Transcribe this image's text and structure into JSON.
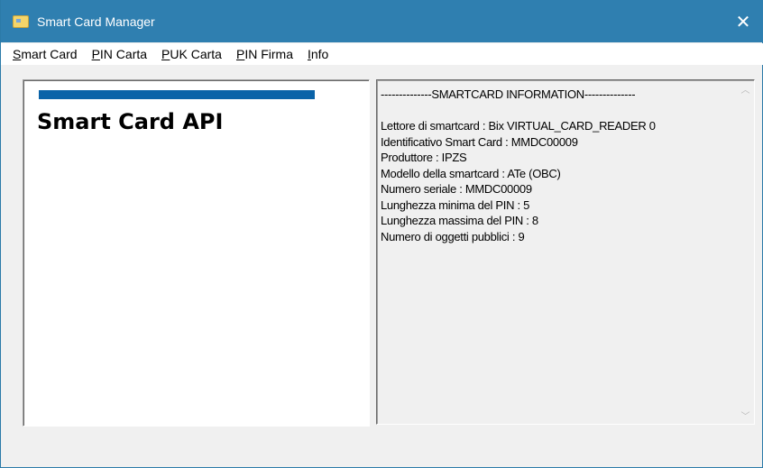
{
  "window": {
    "title": "Smart Card Manager",
    "close_glyph": "✕"
  },
  "menu": [
    {
      "label": "Smart Card",
      "accel": "S",
      "rest": "mart Card"
    },
    {
      "label": "PIN Carta",
      "accel": "P",
      "rest": "IN Carta"
    },
    {
      "label": "PUK Carta",
      "accel": "P",
      "rest": "UK Carta"
    },
    {
      "label": "PIN Firma",
      "accel": "P",
      "rest": "IN Firma"
    },
    {
      "label": "Info",
      "accel": "I",
      "rest": "nfo"
    }
  ],
  "left_panel": {
    "heading": "Smart Card API",
    "accent_color": "#0a63a8"
  },
  "info": {
    "header": "--------------SMARTCARD INFORMATION--------------",
    "lines": [
      "Lettore di smartcard : Bix VIRTUAL_CARD_READER 0",
      "Identificativo Smart Card : MMDC00009",
      "Produttore : IPZS",
      "Modello della smartcard : ATe (OBC)",
      "Numero seriale : MMDC00009",
      "Lunghezza minima del PIN : 5",
      "Lunghezza massima del PIN : 8",
      "Numero di oggetti pubblici : 9"
    ]
  },
  "scrollbar": {
    "up_glyph": "︿",
    "down_glyph": "﹀"
  }
}
